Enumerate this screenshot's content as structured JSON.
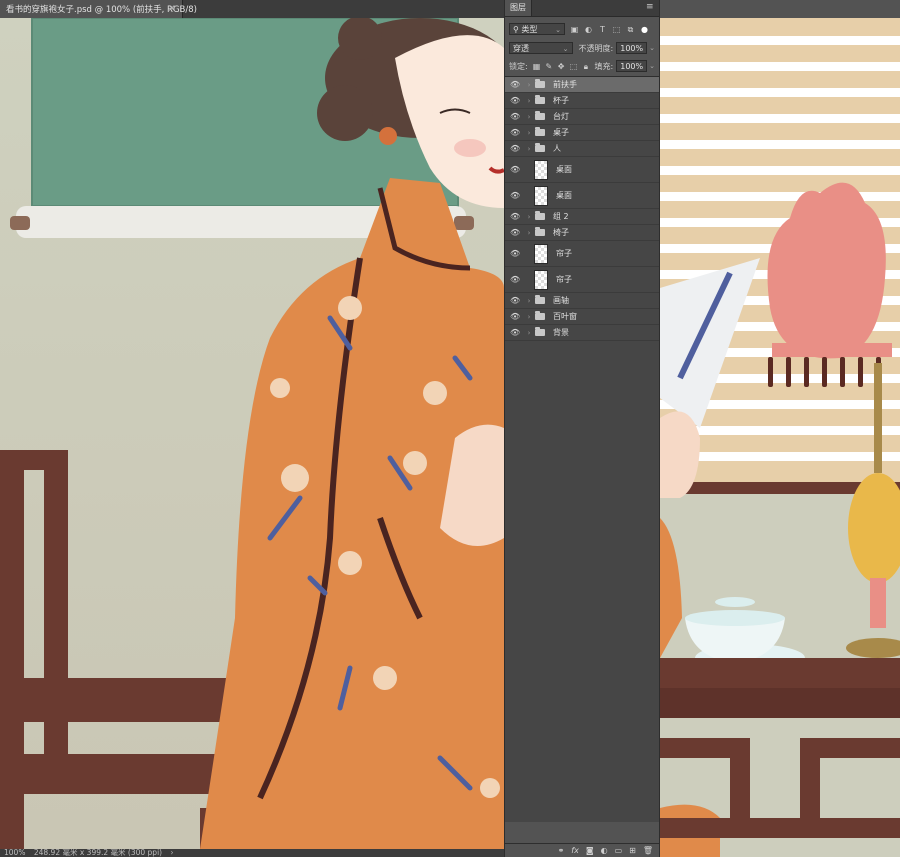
{
  "document": {
    "tab_title": "看书的穿旗袍女子.psd @ 100% (前扶手, RGB/8)",
    "close_glyph": "×"
  },
  "statusbar": {
    "zoom": "100%",
    "doc_size": "248.92 毫米 x 399.2 毫米 (300 ppi)",
    "arrow": "›"
  },
  "layers_panel": {
    "tab_label": "图层",
    "menu_icon": "panel-menu-icon",
    "filter": {
      "label": "类型"
    },
    "blend_mode": "穿透",
    "opacity_label": "不透明度:",
    "opacity": "100%",
    "lock_label": "锁定:",
    "fill_label": "填充:",
    "fill": "100%",
    "layers": [
      {
        "name": "前扶手",
        "kind": "group",
        "selected": true
      },
      {
        "name": "杯子",
        "kind": "group"
      },
      {
        "name": "台灯",
        "kind": "group"
      },
      {
        "name": "桌子",
        "kind": "group"
      },
      {
        "name": "人",
        "kind": "group"
      },
      {
        "name": "桌面",
        "kind": "pixel"
      },
      {
        "name": "桌面",
        "kind": "pixel"
      },
      {
        "name": "组 2",
        "kind": "group"
      },
      {
        "name": "椅子",
        "kind": "group"
      },
      {
        "name": "帘子",
        "kind": "pixel"
      },
      {
        "name": "帘子",
        "kind": "pixel"
      },
      {
        "name": "画轴",
        "kind": "group"
      },
      {
        "name": "百叶窗",
        "kind": "group"
      },
      {
        "name": "背景",
        "kind": "group"
      }
    ],
    "footer_icons": [
      "link-icon",
      "fx-icon",
      "mask-icon",
      "adjustment-icon",
      "new-group-icon",
      "new-layer-icon",
      "trash-icon"
    ]
  },
  "colors": {
    "ui_bg": "#535353",
    "selected_layer": "#6b6b6b",
    "qipao": "#e08a4a",
    "chair": "#6a3a30",
    "scroll_painting": "#6a9c86"
  }
}
